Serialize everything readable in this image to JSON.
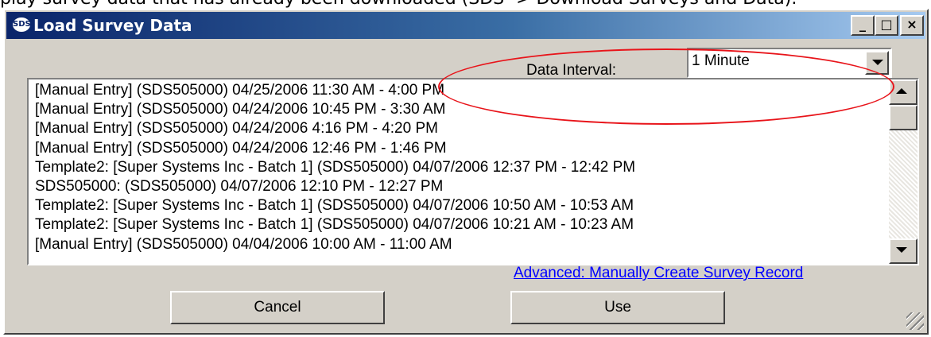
{
  "page_caption": "play survey data that has already been downloaded (SDS -> Download Surveys and Data).",
  "window": {
    "title": "Load Survey Data",
    "icon": "sds-app-icon",
    "controls": {
      "minimize": "_",
      "maximize": "□",
      "close": "×"
    }
  },
  "data_interval": {
    "label": "Data Interval:",
    "selected": "1 Minute"
  },
  "surveys": [
    "[Manual Entry]  (SDS505000) 04/25/2006 11:30 AM - 4:00 PM",
    "[Manual Entry]  (SDS505000) 04/24/2006 10:45 PM - 3:30 AM",
    "[Manual Entry]  (SDS505000) 04/24/2006 4:16 PM - 4:20 PM",
    "[Manual Entry]  (SDS505000) 04/24/2006 12:46 PM - 1:46 PM",
    "Template2: [Super Systems Inc - Batch 1]  (SDS505000) 04/07/2006 12:37 PM - 12:42 PM",
    "SDS505000:  (SDS505000) 04/07/2006 12:10 PM - 12:27 PM",
    "Template2: [Super Systems Inc - Batch 1]  (SDS505000) 04/07/2006 10:50 AM - 10:53 AM",
    "Template2: [Super Systems Inc - Batch 1]  (SDS505000) 04/07/2006 10:21 AM - 10:23 AM",
    "[Manual Entry]  (SDS505000) 04/04/2006 10:00 AM - 11:00 AM"
  ],
  "advanced_link": "Advanced: Manually Create Survey Record",
  "buttons": {
    "cancel": "Cancel",
    "use": "Use"
  },
  "colors": {
    "titlebar_start": "#0a246a",
    "titlebar_end": "#a6caf0",
    "dialog_bg": "#d4d0c8",
    "link": "#0000ff",
    "highlight_annotation": "#e8141a"
  }
}
